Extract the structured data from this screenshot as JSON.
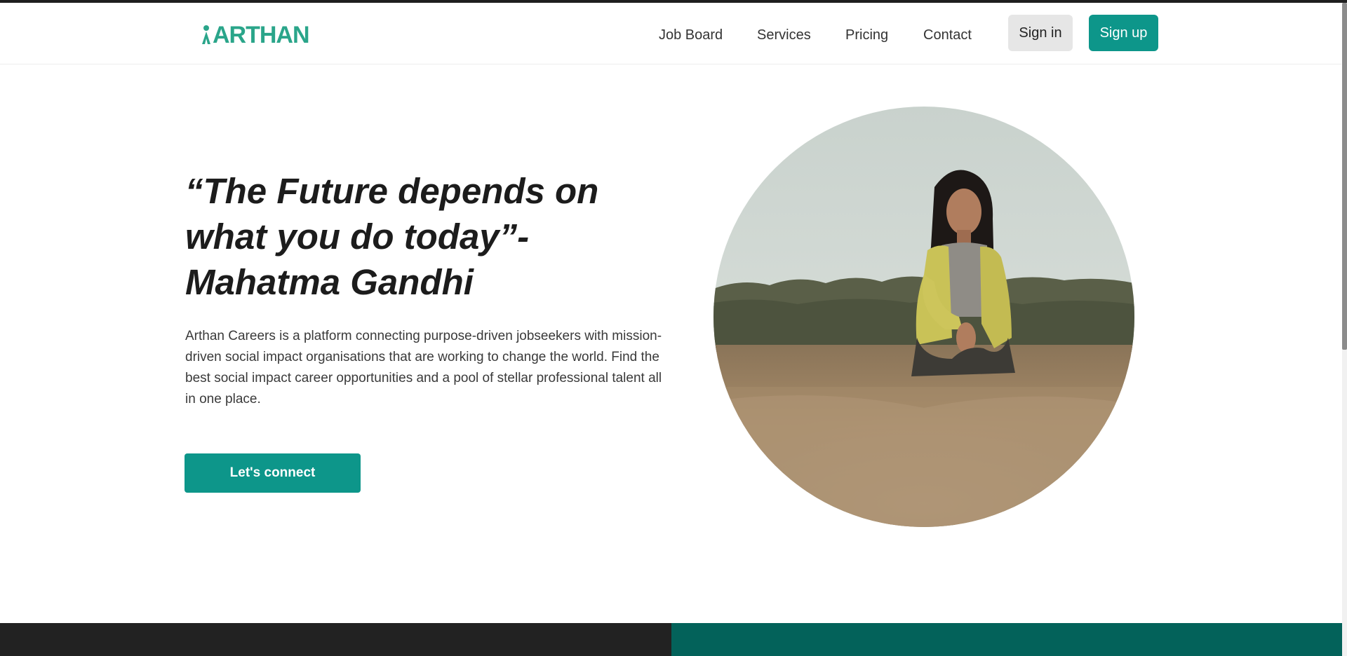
{
  "brand": {
    "logo_text": "ARTHAN",
    "logo_color": "#2aa58a",
    "accent_color": "#0d968a"
  },
  "nav": {
    "links": [
      {
        "label": "Job Board"
      },
      {
        "label": "Services"
      },
      {
        "label": "Pricing"
      },
      {
        "label": "Contact"
      }
    ],
    "signin_label": "Sign in",
    "signup_label": "Sign up"
  },
  "hero": {
    "quote": "“The Future depends on what you do today”- Mahatma Gandhi",
    "description": "Arthan Careers is a platform connecting purpose-driven jobseekers with mission-driven social impact organisations that are working to change the world. Find the best social impact career opportunities and a pool of stellar professional talent all in one place.",
    "cta_label": "Let's connect",
    "image_icon": "woman-in-field-photo"
  },
  "footer": {
    "dark_color": "#222222",
    "teal_color": "#03625a"
  }
}
